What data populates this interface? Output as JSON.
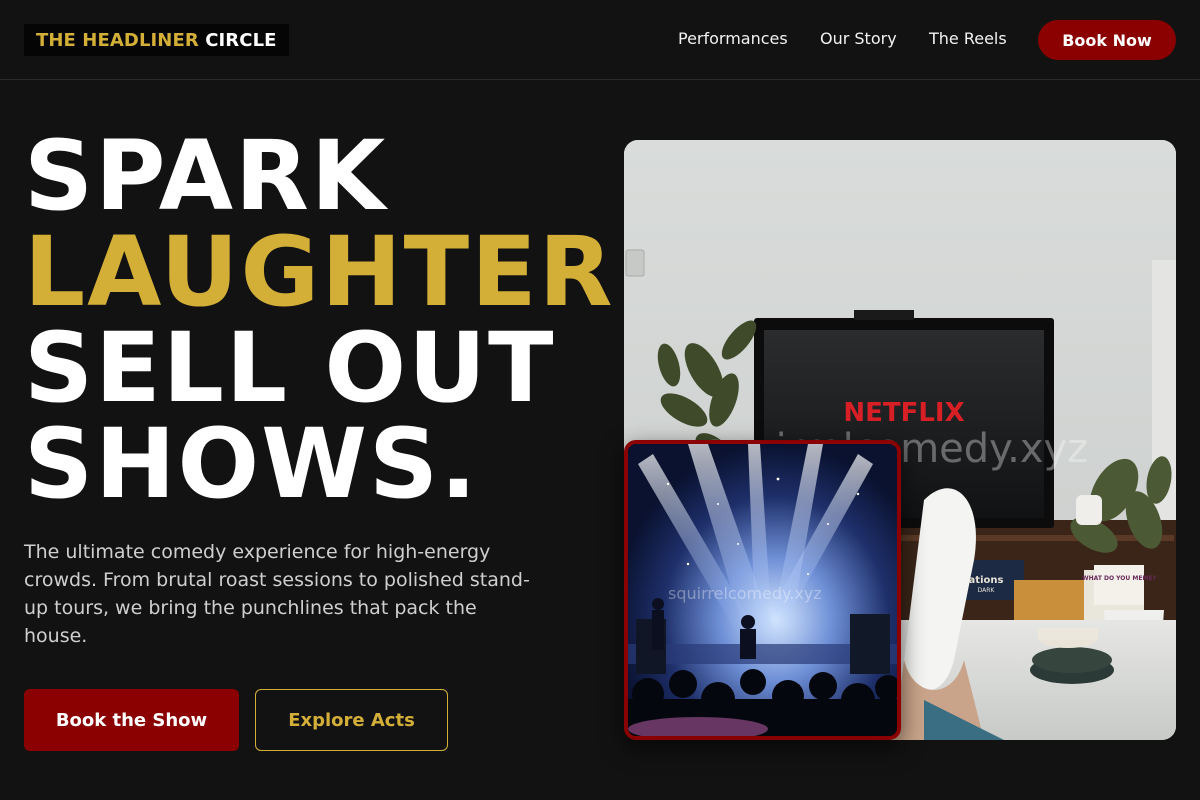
{
  "brand": {
    "name_part1": "THE HEADLINER",
    "name_part2": "CIRCLE"
  },
  "nav": {
    "items": [
      {
        "label": "Performances"
      },
      {
        "label": "Our Story"
      },
      {
        "label": "The Reels"
      }
    ],
    "cta_label": "Book Now"
  },
  "hero": {
    "headline_line1": "SPARK",
    "headline_line2": "LAUGHTER.",
    "headline_line3": "SELL OUT",
    "headline_line4": "SHOWS.",
    "description": "The ultimate comedy experience for high-energy crowds. From brutal roast sessions to polished stand-up tours, we bring the punchlines that pack the house.",
    "primary_button": "Book the Show",
    "secondary_button": "Explore Acts"
  },
  "images": {
    "main_tv_brand": "NETFLIX",
    "main_watermark": "squirrelcomedy.xyz",
    "main_book_title": "ations",
    "main_book_sub": "DARK",
    "main_box_text": "WHAT DO YOU MEME?",
    "inset_watermark": "squirrelcomedy.xyz"
  },
  "colors": {
    "accent_gold": "#d4af37",
    "accent_red": "#8b0000",
    "background": "#121212"
  }
}
